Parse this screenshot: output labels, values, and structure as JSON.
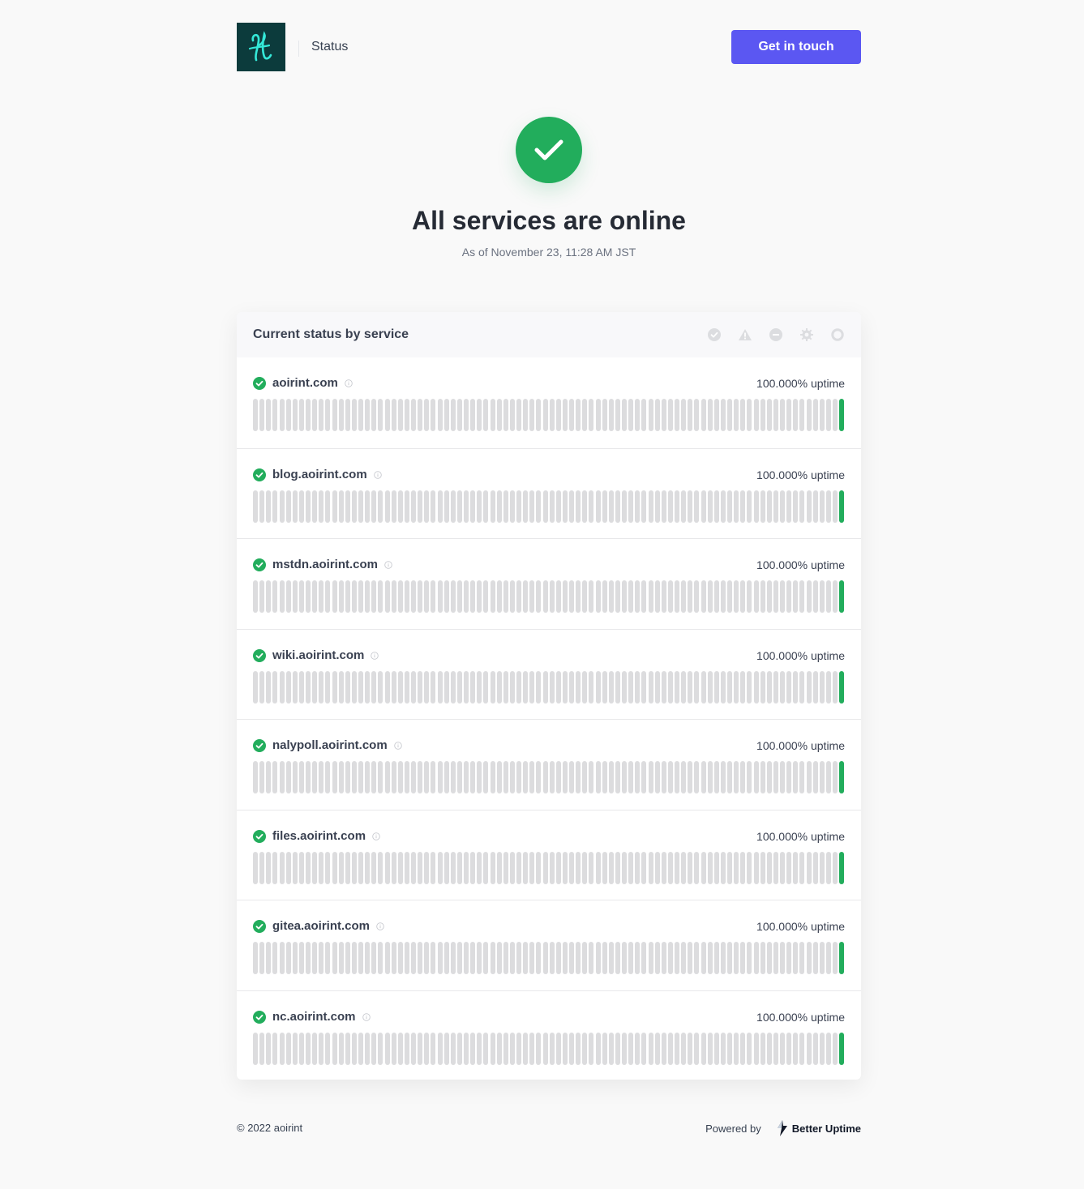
{
  "header": {
    "logo_icon": "script-letter-logo",
    "title": "Status",
    "cta_label": "Get in touch"
  },
  "hero": {
    "icon": "check-icon",
    "title": "All services are online",
    "subtitle": "As of November 23, 11:28 AM JST"
  },
  "panel": {
    "title": "Current status by service",
    "legend_icons": [
      "operational-icon",
      "degraded-icon",
      "downtime-icon",
      "maintenance-icon",
      "not-monitored-icon"
    ],
    "services": [
      {
        "name": "aoirint.com",
        "uptime": "100.000% uptime"
      },
      {
        "name": "blog.aoirint.com",
        "uptime": "100.000% uptime"
      },
      {
        "name": "mstdn.aoirint.com",
        "uptime": "100.000% uptime"
      },
      {
        "name": "wiki.aoirint.com",
        "uptime": "100.000% uptime"
      },
      {
        "name": "nalypoll.aoirint.com",
        "uptime": "100.000% uptime"
      },
      {
        "name": "files.aoirint.com",
        "uptime": "100.000% uptime"
      },
      {
        "name": "gitea.aoirint.com",
        "uptime": "100.000% uptime"
      },
      {
        "name": "nc.aoirint.com",
        "uptime": "100.000% uptime"
      }
    ],
    "history_days": 90,
    "tracked_days": 1
  },
  "footer": {
    "copyright": "© 2022 aoirint",
    "powered_by": "Powered by",
    "brand": "Better Uptime"
  },
  "colors": {
    "brand_button": "#5b57f2",
    "operational": "#22ad5c",
    "no_data": "#dcdcde",
    "logo_bg": "#0c3b3c"
  }
}
